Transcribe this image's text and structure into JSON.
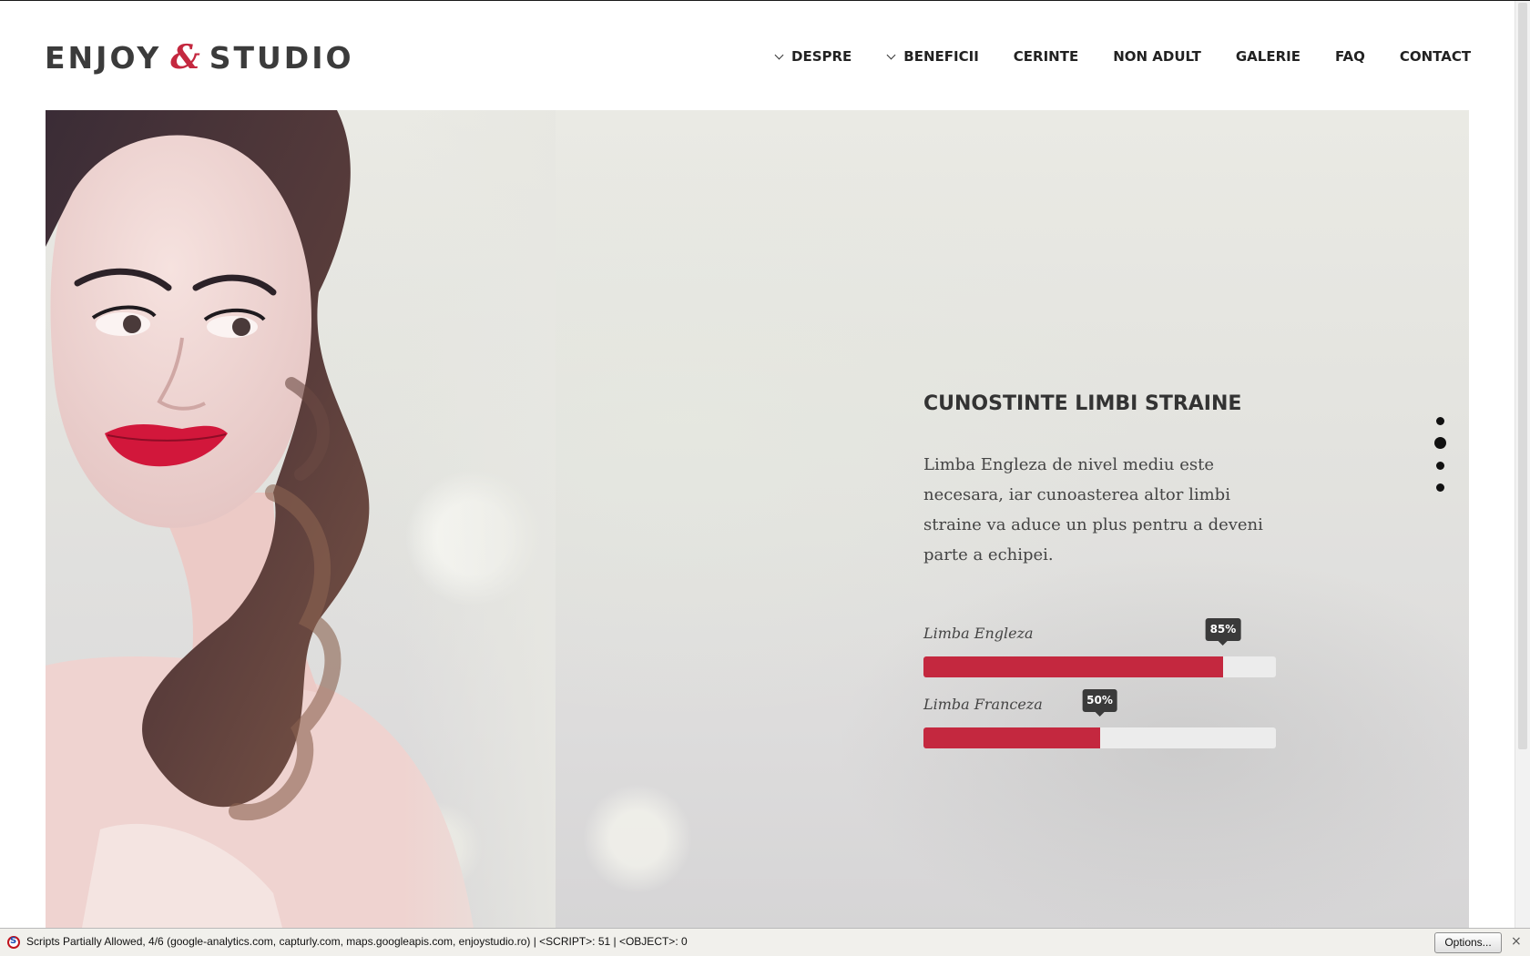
{
  "header": {
    "logo": {
      "left": "ENJOY",
      "amp": "&",
      "right": "STUDIO",
      "accent_color": "#c4283f"
    },
    "nav": [
      {
        "label": "DESPRE",
        "dropdown": true
      },
      {
        "label": "BENEFICII",
        "dropdown": true
      },
      {
        "label": "CERINTE",
        "dropdown": false
      },
      {
        "label": "NON ADULT",
        "dropdown": false
      },
      {
        "label": "GALERIE",
        "dropdown": false
      },
      {
        "label": "FAQ",
        "dropdown": false
      },
      {
        "label": "CONTACT",
        "dropdown": false
      }
    ]
  },
  "hero": {
    "title": "CUNOSTINTE LIMBI STRAINE",
    "text": "Limba Engleza de nivel mediu este necesara, iar cunoasterea altor limbi straine va aduce un plus pentru a deveni parte a echipei.",
    "skills": [
      {
        "label": "Limba Engleza",
        "percent": 85,
        "percent_label": "85%"
      },
      {
        "label": "Limba Franceza",
        "percent": 50,
        "percent_label": "50%"
      }
    ],
    "slide_count": 4,
    "active_slide": 1,
    "bar_color": "#c4283f"
  },
  "statusbar": {
    "icon": "noscript-icon",
    "text": "Scripts Partially Allowed, 4/6 (google-analytics.com, capturly.com, maps.googleapis.com, enjoystudio.ro) | <SCRIPT>: 51 | <OBJECT>: 0",
    "options_label": "Options...",
    "close_label": "×"
  }
}
